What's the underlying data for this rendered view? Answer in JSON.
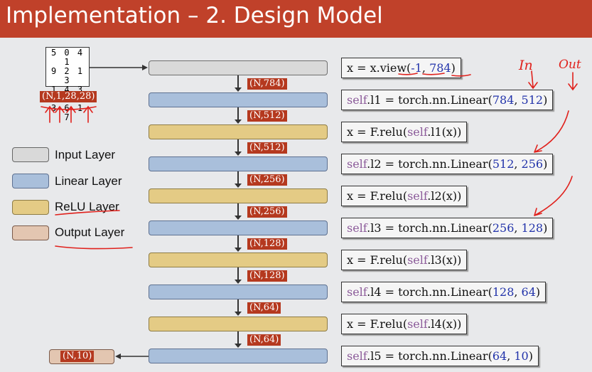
{
  "title": "Implementation – 2. Design Model",
  "input_image": {
    "rows": [
      "5 0 4 1",
      "9 2 1 3",
      "1 4 3 5",
      "3 6 1 7"
    ],
    "shape": "(N,1,28,28)"
  },
  "legend": [
    {
      "label": "Input Layer",
      "color": "#d9d9d9"
    },
    {
      "label": "Linear Layer",
      "color": "#a9bfdb"
    },
    {
      "label": "ReLU Layer",
      "color": "#e4cb85"
    },
    {
      "label": "Output Layer",
      "color": "#e3c6b1"
    }
  ],
  "shapes": [
    "(N,784)",
    "(N,512)",
    "(N,512)",
    "(N,256)",
    "(N,256)",
    "(N,128)",
    "(N,128)",
    "(N,64)",
    "(N,64)"
  ],
  "output_shape": "(N,10)",
  "code": {
    "view": {
      "pre": "x = x.",
      "fn": "view",
      "open": "(",
      "a": "-1",
      "sep": ", ",
      "b": "784",
      "close": ")"
    },
    "l1": {
      "kw": "self",
      "mid": ".l1 = torch.nn.Linear(",
      "a": "784",
      "sep": ", ",
      "b": "512",
      "close": ")"
    },
    "r1": {
      "pre": "x = F.relu(",
      "kw": "self",
      "post": ".l1(x))"
    },
    "l2": {
      "kw": "self",
      "mid": ".l2 = torch.nn.Linear(",
      "a": "512",
      "sep": ", ",
      "b": "256",
      "close": ")"
    },
    "r2": {
      "pre": "x = F.relu(",
      "kw": "self",
      "post": ".l2(x))"
    },
    "l3": {
      "kw": "self",
      "mid": ".l3 = torch.nn.Linear(",
      "a": "256",
      "sep": ", ",
      "b": "128",
      "close": ")"
    },
    "r3": {
      "pre": "x = F.relu(",
      "kw": "self",
      "post": ".l3(x))"
    },
    "l4": {
      "kw": "self",
      "mid": ".l4 = torch.nn.Linear(",
      "a": "128",
      "sep": ", ",
      "b": "64",
      "close": ")"
    },
    "r4": {
      "pre": "x = F.relu(",
      "kw": "self",
      "post": ".l4(x))"
    },
    "l5": {
      "kw": "self",
      "mid": ".l5 = torch.nn.Linear(",
      "a": "64",
      "sep": ", ",
      "b": "10",
      "close": ")"
    }
  },
  "annotations": {
    "in": "In",
    "out": "Out"
  },
  "colors": {
    "title_bar": "#c0412a",
    "keyword": "#8c5b9a",
    "number": "#2233aa",
    "ink": "#e0211c"
  }
}
